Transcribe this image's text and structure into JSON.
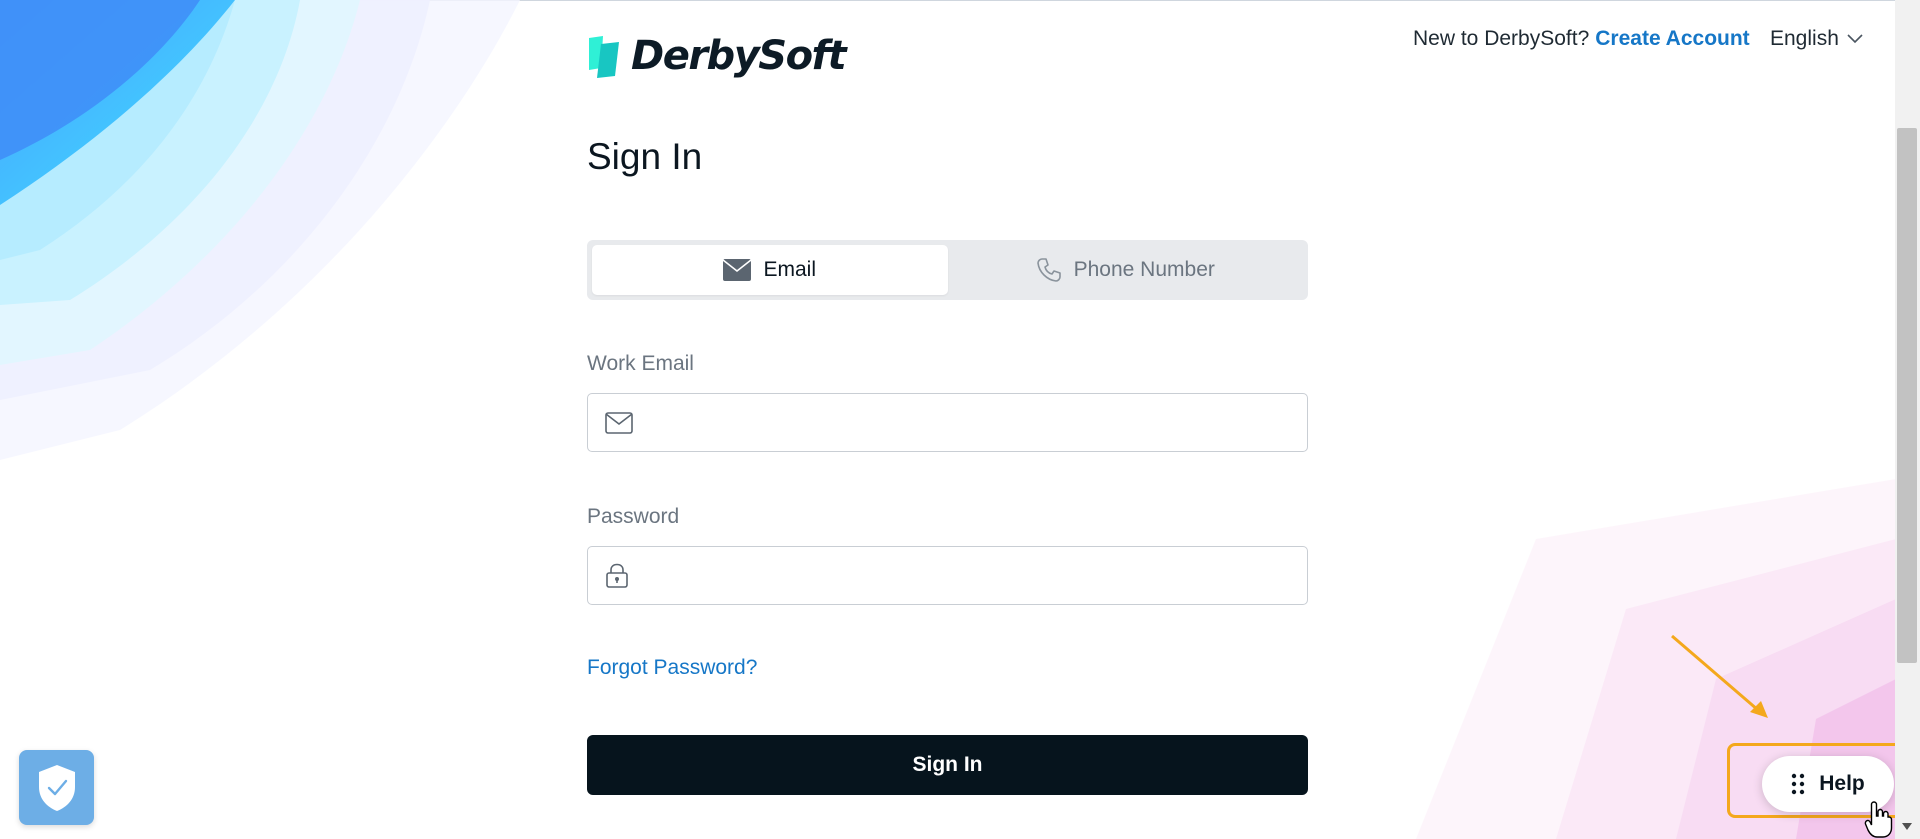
{
  "header": {
    "brand": "DerbySoft",
    "new_prompt": "New to DerbySoft?",
    "create_account": "Create Account",
    "language": "English"
  },
  "main": {
    "title": "Sign In",
    "tabs": [
      {
        "label": "Email",
        "icon": "envelope-icon",
        "active": true
      },
      {
        "label": "Phone Number",
        "icon": "phone-icon",
        "active": false
      }
    ],
    "email": {
      "label": "Work Email",
      "value": "",
      "icon": "envelope-outline-icon"
    },
    "password": {
      "label": "Password",
      "value": "",
      "icon": "lock-icon"
    },
    "forgot": "Forgot Password?",
    "submit": "Sign In"
  },
  "widgets": {
    "help_label": "Help",
    "help_icon": "grid-dots-icon",
    "security_icon": "shield-check-icon"
  },
  "colors": {
    "link": "#1677c7",
    "button": "#06141d",
    "highlight": "#f4a81c",
    "logo_mark": "#1fd1c9",
    "badge": "#6daee6"
  }
}
